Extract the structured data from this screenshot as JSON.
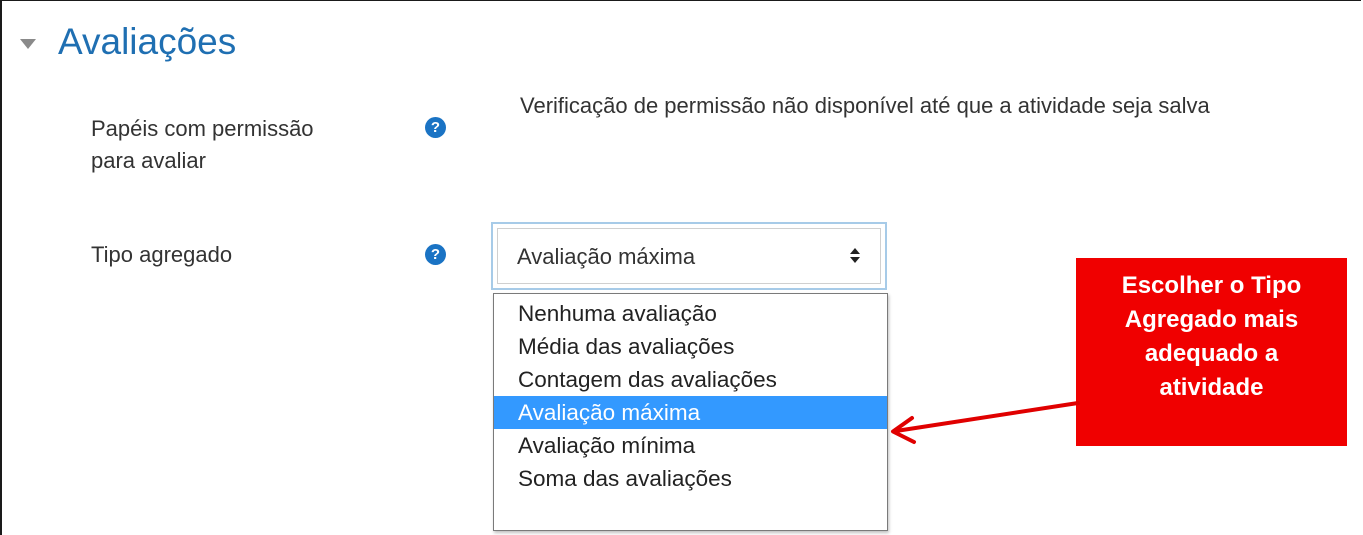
{
  "section": {
    "title": "Avaliações",
    "collapse_icon": "triangle-down-icon"
  },
  "roles_field": {
    "label_line1": "Papéis com permissão",
    "label_line2": "para avaliar",
    "help_icon": "question-circle-icon",
    "help_glyph": "?",
    "static_text": "Verificação de permissão não disponível até que a atividade seja salva"
  },
  "aggregate_field": {
    "label": "Tipo agregado",
    "help_icon": "question-circle-icon",
    "help_glyph": "?",
    "selected_value": "Avaliação máxima",
    "options": [
      "Nenhuma avaliação",
      "Média das avaliações",
      "Contagem das avaliações",
      "Avaliação máxima",
      "Avaliação mínima",
      "Soma das avaliações"
    ],
    "selected_index": 3
  },
  "callout": {
    "lines": [
      "Escolher o Tipo",
      "Agregado mais",
      "adequado a",
      "atividade"
    ],
    "background": "#f00000",
    "arrow_color": "#e00000"
  },
  "colors": {
    "title": "#1f6fb2",
    "help_icon": "#1a73c4",
    "selected_option": "#3399ff"
  }
}
